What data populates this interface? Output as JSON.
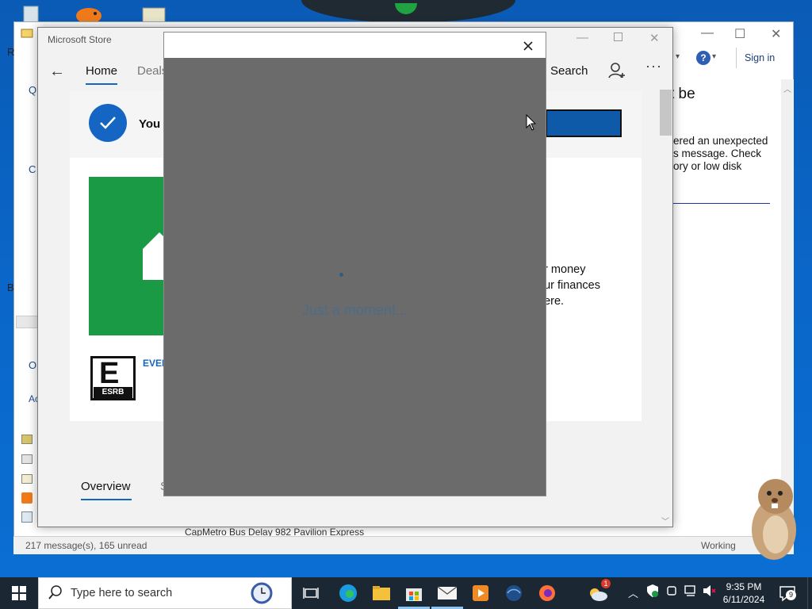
{
  "mail": {
    "toolbar": {
      "sign_in_label": "Sign in"
    },
    "left_letters": [
      "R",
      "Q",
      "C",
      "B",
      "O",
      "Ac"
    ],
    "content_lines": [
      "t be",
      "ered an unexpected",
      "s message. Check",
      "ory or low disk"
    ],
    "status_text": "217 message(s), 165 unread",
    "status_right": "Working",
    "bottom_snippet": "CapMetro Bus Delay 982 Pavilion Express"
  },
  "store": {
    "window_title": "Microsoft Store",
    "nav": {
      "home_label": "Home",
      "deals_label": "Deals",
      "search_label": "Search"
    },
    "banner_text": "You c",
    "esrb_rating_text": "EVER",
    "esrb_logo_letter": "E",
    "esrb_logo_word": "ESRB",
    "description_lines": [
      "ur money",
      "our finances",
      "here."
    ],
    "tabs": {
      "overview_label": "Overview",
      "second_label": "S"
    }
  },
  "modal": {
    "loading_text": "Just a moment..."
  },
  "taskbar": {
    "search_placeholder": "Type here to search",
    "time": "9:35 PM",
    "date": "6/11/2024",
    "notification_count": "9",
    "weather_badge": "1"
  },
  "colors": {
    "desktop_blue": "#0a66c8",
    "store_accent": "#1466c2",
    "app_tile_green": "#1a9a44",
    "modal_gray": "#6b6b6b",
    "taskbar": "#1b2733"
  }
}
